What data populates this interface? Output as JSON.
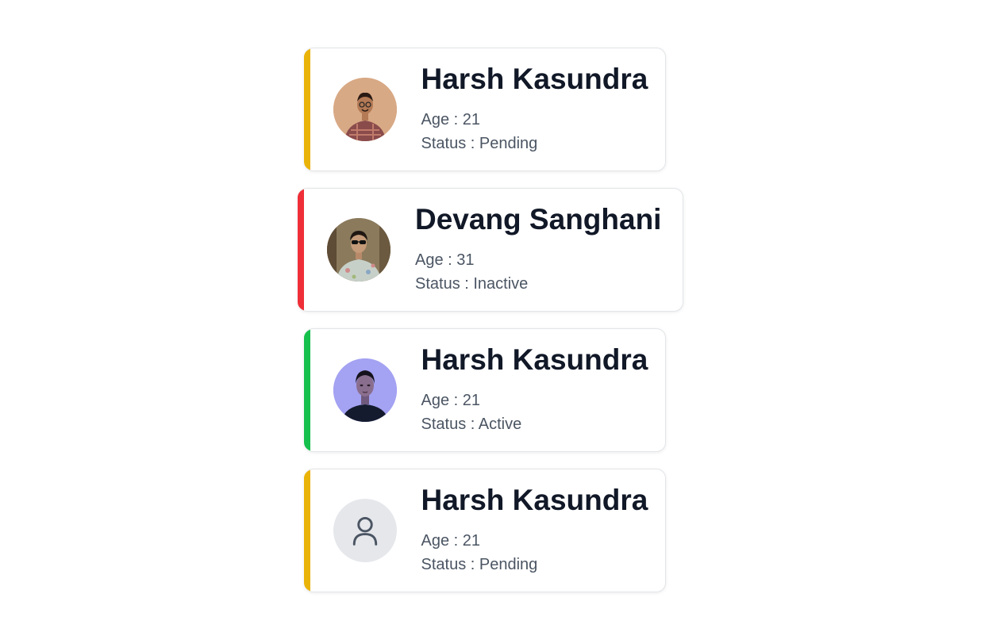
{
  "people": [
    {
      "name": "Harsh Kasundra",
      "age_label": "Age",
      "age": "21",
      "status_label": "Status",
      "status": "Pending",
      "status_color": "#eab308",
      "avatar": "photo-man-plaid"
    },
    {
      "name": "Devang Sanghani",
      "age_label": "Age",
      "age": "31",
      "status_label": "Status",
      "status": "Inactive",
      "status_color": "#ef2f38",
      "avatar": "photo-man-sunglasses"
    },
    {
      "name": "Harsh Kasundra",
      "age_label": "Age",
      "age": "21",
      "status_label": "Status",
      "status": "Active",
      "status_color": "#16c04c",
      "avatar": "photo-woman-blue"
    },
    {
      "name": "Harsh Kasundra",
      "age_label": "Age",
      "age": "21",
      "status_label": "Status",
      "status": "Pending",
      "status_color": "#eab308",
      "avatar": "user-icon"
    }
  ]
}
